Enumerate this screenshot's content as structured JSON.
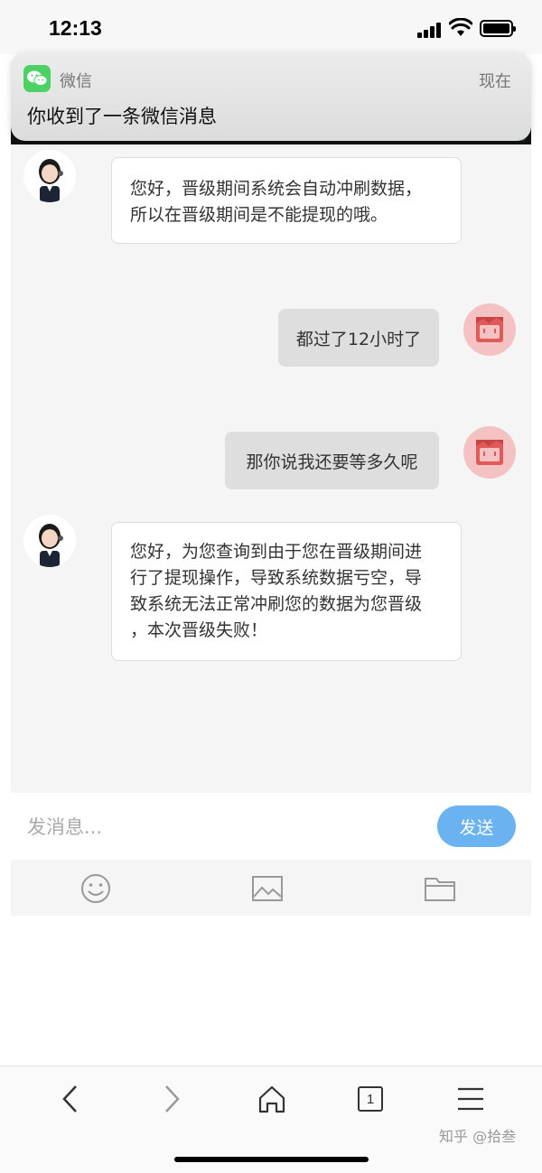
{
  "status_bar": {
    "time": "12:13"
  },
  "notification": {
    "app_name": "微信",
    "time": "现在",
    "message": "你收到了一条微信消息"
  },
  "chat": {
    "messages": [
      {
        "from": "agent",
        "text_lines": [
          "您好，晋级期间系统会自动冲刷数据，",
          "所以在晋级期间是不能提现的哦。"
        ]
      },
      {
        "from": "user",
        "text": "都过了12小时了"
      },
      {
        "from": "user",
        "text": "那你说我还要等多久呢"
      },
      {
        "from": "agent",
        "text_lines": [
          "您好，为您查询到由于您在晋级期间进",
          "行了提现操作，导致系统数据亏空，导",
          "致系统无法正常冲刷您的数据为您晋级",
          "，本次晋级失败！"
        ]
      }
    ]
  },
  "input": {
    "placeholder": "发消息...",
    "send_label": "发送"
  },
  "toolbar": {
    "icons": [
      "emoji-icon",
      "image-icon",
      "folder-icon"
    ]
  },
  "browser_nav": {
    "tab_count": "1",
    "icons": [
      "back-icon",
      "forward-icon",
      "home-icon",
      "tabs-icon",
      "menu-icon"
    ]
  },
  "watermark": "知乎 @拾叁",
  "colors": {
    "send_button": "#6bb3f0",
    "wechat_green": "#4cd264",
    "user_avatar": "#e05a5a"
  }
}
